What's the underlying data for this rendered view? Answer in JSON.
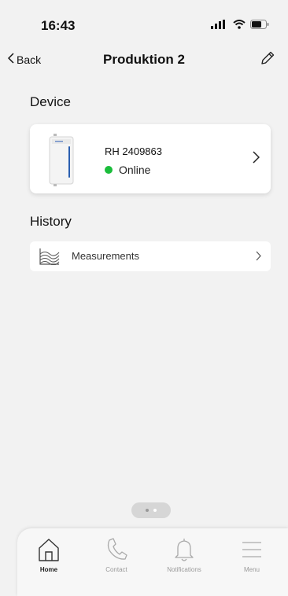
{
  "status_bar": {
    "time": "16:43",
    "icons": [
      "signal-icon",
      "wifi-icon",
      "battery-icon"
    ]
  },
  "nav": {
    "back_label": "Back",
    "title": "Produktion 2",
    "edit_icon": "pencil-icon"
  },
  "device_section": {
    "title": "Device",
    "card": {
      "name": "RH 2409863",
      "status": "Online",
      "status_color": "#1bbd3b"
    }
  },
  "history_section": {
    "title": "History",
    "items": [
      {
        "label": "Measurements",
        "icon": "chart-area-icon"
      }
    ]
  },
  "page_indicator": {
    "pages": 2,
    "active": 1
  },
  "tab_bar": {
    "tabs": [
      {
        "label": "Home",
        "icon": "home-icon",
        "active": true
      },
      {
        "label": "Contact",
        "icon": "phone-icon",
        "active": false
      },
      {
        "label": "Notifications",
        "icon": "bell-icon",
        "active": false
      },
      {
        "label": "Menu",
        "icon": "menu-icon",
        "active": false
      }
    ]
  }
}
